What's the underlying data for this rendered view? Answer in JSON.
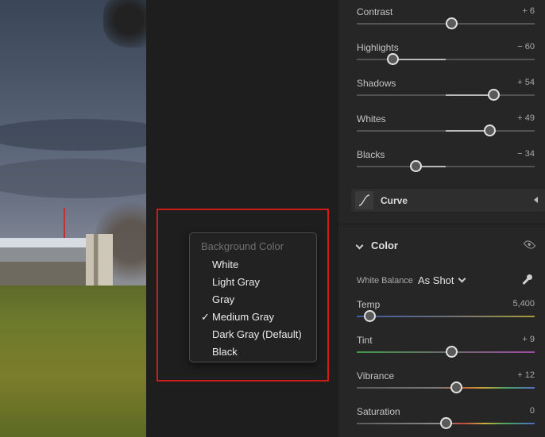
{
  "menu": {
    "title": "Background Color",
    "items": [
      {
        "label": "White",
        "checked": false
      },
      {
        "label": "Light Gray",
        "checked": false
      },
      {
        "label": "Gray",
        "checked": false
      },
      {
        "label": "Medium Gray",
        "checked": true
      },
      {
        "label": "Dark Gray (Default)",
        "checked": false
      },
      {
        "label": "Black",
        "checked": false
      }
    ],
    "check_glyph": "✓"
  },
  "light": {
    "contrast": {
      "label": "Contrast",
      "value": "+ 6",
      "level": 6,
      "min": -100,
      "max": 100
    },
    "highlights": {
      "label": "Highlights",
      "value": "− 60",
      "level": -60,
      "min": -100,
      "max": 100
    },
    "shadows": {
      "label": "Shadows",
      "value": "+ 54",
      "level": 54,
      "min": -100,
      "max": 100
    },
    "whites": {
      "label": "Whites",
      "value": "+ 49",
      "level": 49,
      "min": -100,
      "max": 100
    },
    "blacks": {
      "label": "Blacks",
      "value": "− 34",
      "level": -34,
      "min": -100,
      "max": 100
    }
  },
  "curve": {
    "label": "Curve"
  },
  "color": {
    "title": "Color",
    "white_balance_label": "White Balance",
    "white_balance_value": "As Shot",
    "temp": {
      "label": "Temp",
      "value": "5,400",
      "level": 5400,
      "min": 2000,
      "max": 50000
    },
    "tint": {
      "label": "Tint",
      "value": "+ 9",
      "level": 9,
      "min": -150,
      "max": 150
    },
    "vibrance": {
      "label": "Vibrance",
      "value": "+ 12",
      "level": 12,
      "min": -100,
      "max": 100
    },
    "saturation": {
      "label": "Saturation",
      "value": "0",
      "level": 0,
      "min": -100,
      "max": 100
    }
  },
  "icons": [
    "curve-icon",
    "collapse-arrow-icon",
    "chevron-down-icon",
    "eye-icon",
    "eyedropper-icon",
    "checkmark-icon"
  ]
}
